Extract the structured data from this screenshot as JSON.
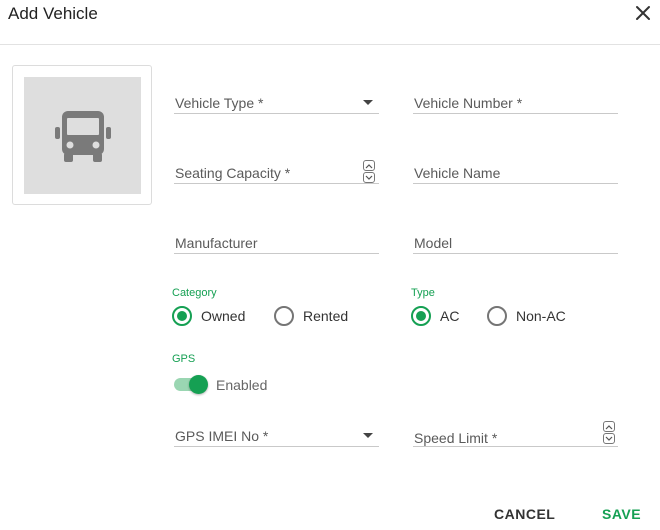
{
  "dialog": {
    "title": "Add Vehicle"
  },
  "fields": {
    "vehicle_type": "Vehicle Type *",
    "vehicle_number": "Vehicle Number *",
    "seating_capacity": "Seating Capacity *",
    "vehicle_name": "Vehicle Name",
    "manufacturer": "Manufacturer",
    "model": "Model",
    "gps_imei": "GPS IMEI No *",
    "speed_limit": "Speed Limit *"
  },
  "category": {
    "label": "Category",
    "options": [
      "Owned",
      "Rented"
    ],
    "selected": "Owned"
  },
  "type": {
    "label": "Type",
    "options": [
      "AC",
      "Non-AC"
    ],
    "selected": "AC"
  },
  "gps": {
    "label": "GPS",
    "toggle_label": "Enabled",
    "enabled": true
  },
  "actions": {
    "cancel": "CANCEL",
    "save": "SAVE"
  },
  "colors": {
    "accent": "#15a053",
    "placeholder_bg": "#dedede"
  },
  "icons": {
    "vehicle": "bus-icon",
    "close": "close-icon"
  }
}
